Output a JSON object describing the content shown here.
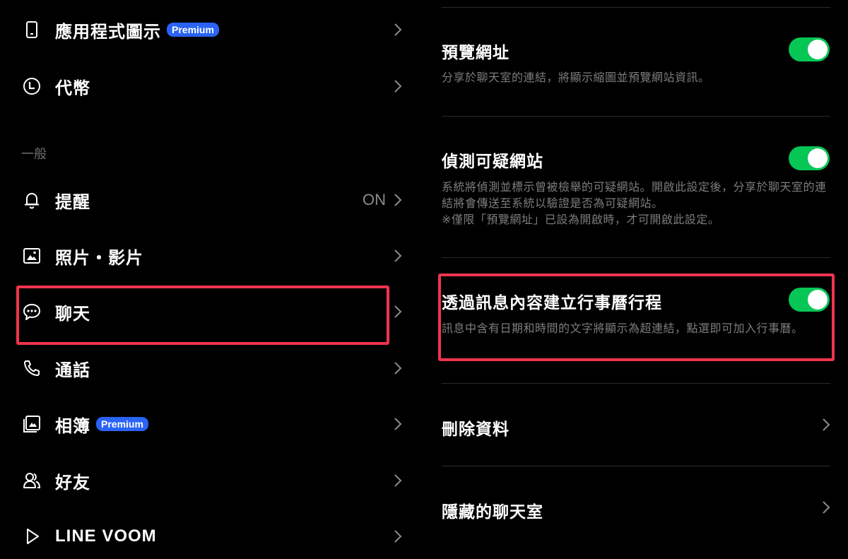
{
  "left": {
    "items_top": [
      {
        "icon": "phone-device-icon",
        "label": "應用程式圖示",
        "badge": "Premium"
      },
      {
        "icon": "clock-coin-icon",
        "label": "代幣"
      }
    ],
    "section_label": "一般",
    "items_general": [
      {
        "icon": "bell-icon",
        "label": "提醒",
        "status": "ON"
      },
      {
        "icon": "photo-icon",
        "label": "照片・影片"
      },
      {
        "icon": "chat-bubble-icon",
        "label": "聊天"
      },
      {
        "icon": "phone-icon",
        "label": "通話"
      },
      {
        "icon": "album-icon",
        "label": "相簿",
        "badge": "Premium"
      },
      {
        "icon": "friends-icon",
        "label": "好友"
      },
      {
        "icon": "voom-icon",
        "label": "LINE VOOM"
      }
    ]
  },
  "right": {
    "preview_url": {
      "title": "預覽網址",
      "description": "分享於聊天室的連結，將顯示縮圖並預覽網站資訊。",
      "enabled": true
    },
    "detect_suspicious": {
      "title": "偵測可疑網站",
      "description": "系統將偵測並標示曾被檢舉的可疑網站。開啟此設定後，分享於聊天室的連結將會傳送至系統以驗證是否為可疑網站。\n※僅限「預覽網址」已設為開啟時，才可開啟此設定。",
      "enabled": true
    },
    "calendar_events": {
      "title": "透過訊息內容建立行事曆行程",
      "description": "訊息中含有日期和時間的文字將顯示為超連結，點選即可加入行事曆。",
      "enabled": true
    },
    "delete_data": {
      "title": "刪除資料"
    },
    "hidden_chats": {
      "title": "隱藏的聊天室"
    }
  },
  "colors": {
    "accent_toggle": "#06c755",
    "badge": "#2a63f5",
    "highlight": "#f0344f"
  }
}
